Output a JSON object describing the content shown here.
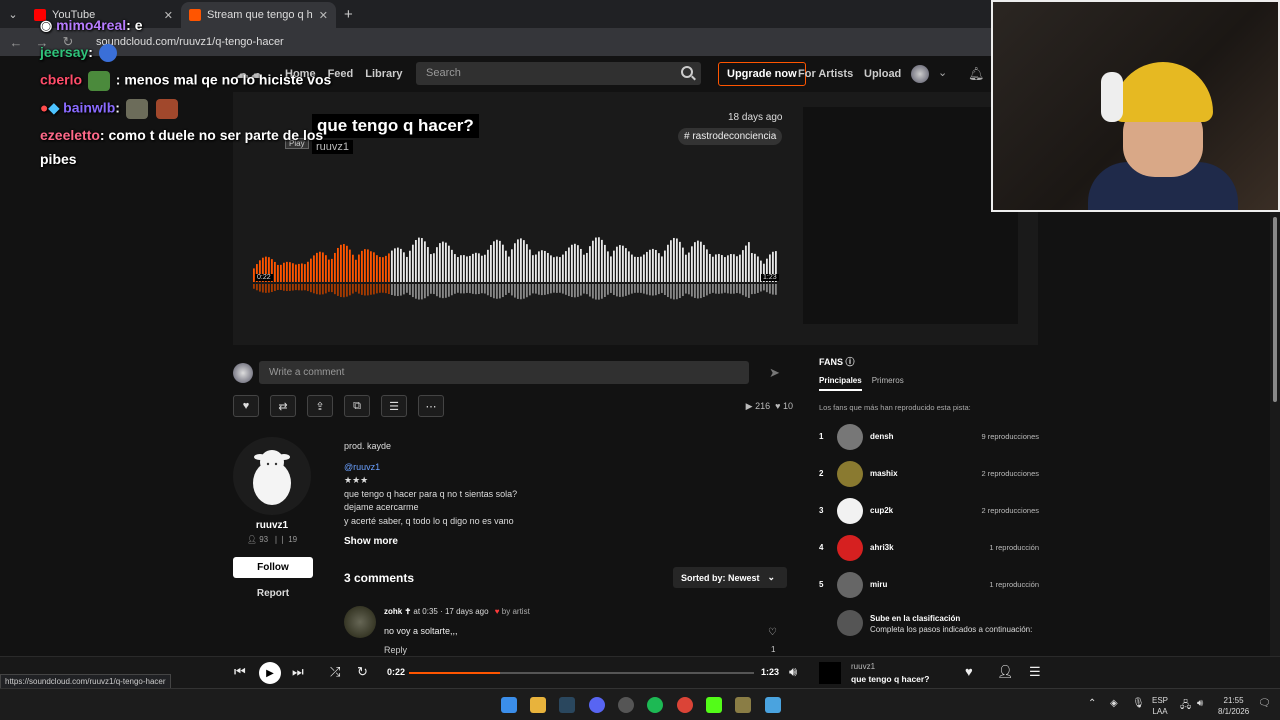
{
  "browser": {
    "tabs": [
      {
        "title": "YouTube",
        "active": false
      },
      {
        "title": "Stream que tengo q hacer? by",
        "active": true
      }
    ],
    "url": "soundcloud.com/ruuvz1/q-tengo-hacer",
    "status_url": "https://soundcloud.com/ruuvz1/q-tengo-hacer"
  },
  "header": {
    "nav": [
      "Home",
      "Feed",
      "Library"
    ],
    "search_placeholder": "Search",
    "upgrade_label": "Upgrade now",
    "for_artists_label": "For Artists",
    "upload_label": "Upload"
  },
  "hero": {
    "title": "que tengo q hacer?",
    "artist": "ruuvz1",
    "date": "18 days ago",
    "tag": "# rastrodeconciencia",
    "play_hint": "Play",
    "time_current": "0:22",
    "time_total": "1:23",
    "progress_fraction": 0.265
  },
  "comment_input": {
    "placeholder": "Write a comment"
  },
  "stats": {
    "plays": "216",
    "likes": "10"
  },
  "artist": {
    "name": "ruuvz1",
    "followers": "93",
    "tracks": "19",
    "follow_label": "Follow",
    "report_label": "Report"
  },
  "description": {
    "lines": [
      "prod. kayde",
      "",
      "@ruuvz1",
      "★★★",
      "que tengo q hacer para q no t sientas sola?",
      "dejame acercarme",
      "y acerté saber, q todo lo q digo no es vano"
    ],
    "show_more": "Show more"
  },
  "comments": {
    "heading": "3 comments",
    "sort_label": "Sorted by: Newest",
    "first": {
      "user": "zohk ✝",
      "meta": "at 0:35 · 17 days ago",
      "by_artist": "by artist",
      "text": "no voy a soltarte,,,",
      "reply": "Reply",
      "likes": "1"
    }
  },
  "fans": {
    "heading": "FANS",
    "tabs": [
      "Principales",
      "Primeros"
    ],
    "subtitle": "Los fans que más han reproducido esta pista:",
    "list": [
      {
        "rank": "1",
        "name": "densh",
        "plays": "9 reproducciones",
        "color": "#777777"
      },
      {
        "rank": "2",
        "name": "mashix",
        "plays": "2 reproducciones",
        "color": "#8a7a30"
      },
      {
        "rank": "3",
        "name": "cup2k",
        "plays": "2 reproducciones",
        "color": "#f2f2f2"
      },
      {
        "rank": "4",
        "name": "ahri3k",
        "plays": "1 reproducción",
        "color": "#d62020"
      },
      {
        "rank": "5",
        "name": "miru",
        "plays": "1 reproducción",
        "color": "#666666"
      }
    ],
    "climb_title": "Sube en la clasificación",
    "climb_sub": "Completa los pasos indicados a continuación:"
  },
  "chat": [
    {
      "user": "mimo4real",
      "text": ": e",
      "color": "#b77cff"
    },
    {
      "user": "jeersay",
      "text": ":",
      "color": "#2fc27a"
    },
    {
      "user": "cberlo",
      "text": ": menos mal qe no lo hiciste vos",
      "color": "#ff4d6a"
    },
    {
      "user": "bainwlb",
      "text": ":",
      "color": "#8a6bff"
    },
    {
      "user": "ezeeletto",
      "text": ": como t duele no ser parte de los",
      "color": "#ff6a8a"
    },
    {
      "user": "",
      "text": "pibes",
      "color": "#ffffff"
    }
  ],
  "player": {
    "current": "0:22",
    "total": "1:23",
    "progress_fraction": 0.265,
    "artist": "ruuvz1",
    "title": "que tengo q hacer?"
  },
  "taskbar": {
    "lang": "ESP",
    "layout": "LAA",
    "time": "21:55",
    "date": "8/1/2026"
  },
  "colors": {
    "accent": "#ff5500"
  }
}
